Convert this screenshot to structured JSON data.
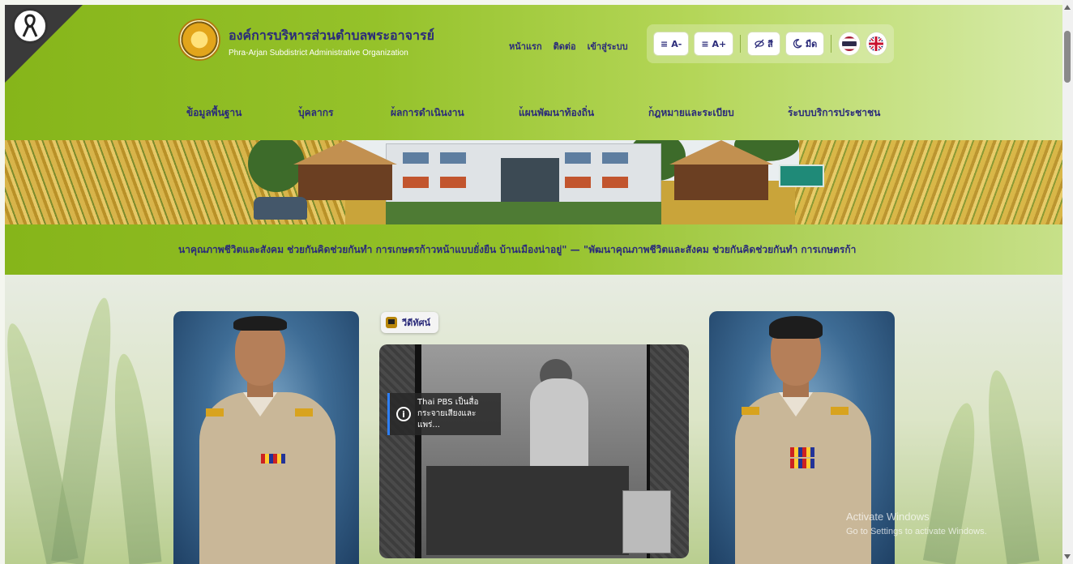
{
  "header": {
    "org_name_th": "องค์การบริหารส่วนตำบลพระอาจารย์",
    "org_name_en": "Phra-Arjan Subdistrict Administrative Organization",
    "top_links": [
      "หน้าแรก",
      "ติดต่อ",
      "เข้าสู่ระบบ"
    ],
    "tools": {
      "font_decrease": "A-",
      "font_increase": "A+",
      "color_mode": "สี",
      "dark_mode": "มืด"
    },
    "languages": [
      "thai-flag-icon",
      "uk-flag-icon"
    ]
  },
  "nav": {
    "items": [
      "ข้อมูลพื้นฐาน",
      "บุคลากร",
      "ผลการดำเนินงาน",
      "แผนพัฒนาท้องถิ่น",
      "กฎหมายและระเบียบ",
      "ระบบบริการประชาชน"
    ],
    "dropdown_glyph": "˅"
  },
  "marquee": {
    "text": "นาคุณภาพชีวิตและสังคม ช่วยกันคิดช่วยกันทำ การเกษตรก้าวหน้าแบบยั่งยืน บ้านเมืองน่าอยู่\" — \"พัฒนาคุณภาพชีวิตและสังคม ช่วยกันคิดช่วยกันทำ การเกษตรก้า"
  },
  "video": {
    "tag_label": "วีดีทัศน์",
    "caption_line1": "Thai PBS เป็นสื่อ",
    "caption_line2": "กระจายเสียงและแพร่..."
  },
  "watermark": {
    "line1": "Activate Windows",
    "line2": "Go to Settings to activate Windows."
  },
  "colors": {
    "header_green": "#86b51a",
    "nav_text": "#2b2b7a",
    "caption_accent": "#2d7ff9"
  }
}
